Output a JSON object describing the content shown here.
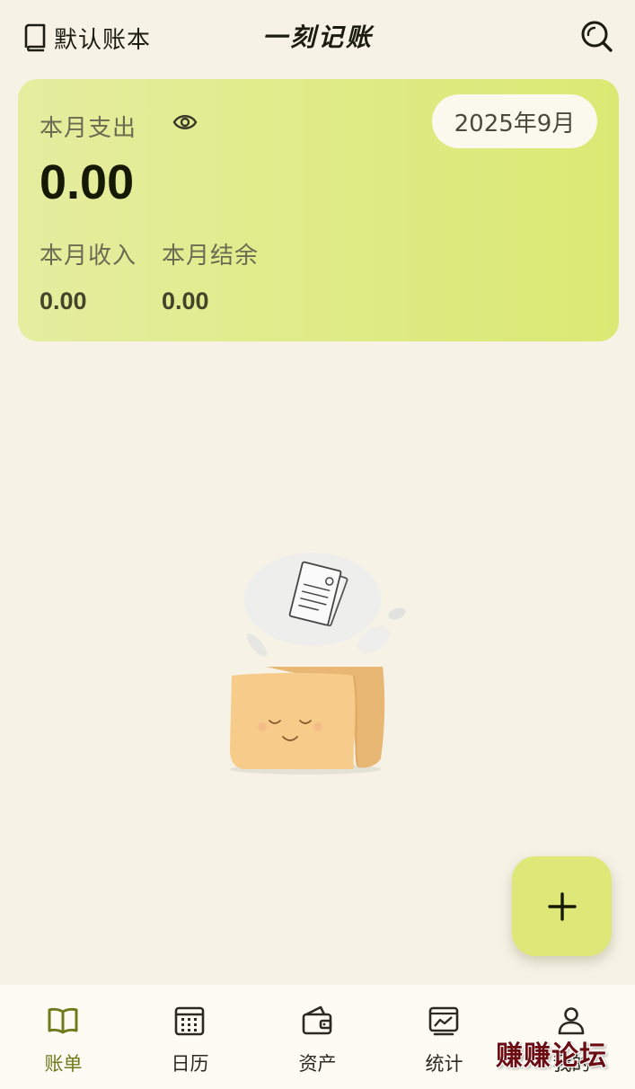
{
  "header": {
    "ledger_label": "默认账本",
    "app_title": "一刻记账",
    "search_icon": "search-icon",
    "book_icon": "book-icon"
  },
  "summary": {
    "expense_label": "本月支出",
    "expense_value": "0.00",
    "month": "2025年9月",
    "income_label": "本月收入",
    "income_value": "0.00",
    "balance_label": "本月结余",
    "balance_value": "0.00",
    "eye_icon": "eye-icon"
  },
  "empty_state": {
    "illustration": "empty-wallet-illustration"
  },
  "fab": {
    "icon": "plus-icon"
  },
  "nav": {
    "items": [
      {
        "label": "账单",
        "icon": "open-book-icon",
        "active": true
      },
      {
        "label": "日历",
        "icon": "calendar-icon",
        "active": false
      },
      {
        "label": "资产",
        "icon": "wallet-icon",
        "active": false
      },
      {
        "label": "统计",
        "icon": "chart-icon",
        "active": false
      },
      {
        "label": "我的",
        "icon": "person-icon",
        "active": false
      }
    ]
  },
  "watermark": "赚赚论坛",
  "colors": {
    "background": "#f6f2e6",
    "card_gradient_start": "#e5eda0",
    "card_gradient_end": "#dbe974",
    "accent_active": "#6e7a1c",
    "fab": "#dde879"
  }
}
